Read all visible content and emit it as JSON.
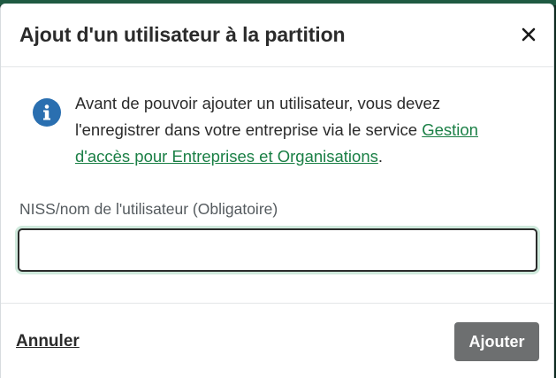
{
  "dialog": {
    "title": "Ajout d'un utilisateur à la partition",
    "close_icon": "close-icon"
  },
  "info": {
    "icon": "info-icon",
    "text_before": "Avant de pouvoir ajouter un utilisateur, vous devez l'enregistrer dans votre entreprise via le service ",
    "link_text": "Gestion d'accès pour Entreprises et Organisations",
    "text_after": ".",
    "link_color": "#1a7f45",
    "icon_color": "#2a6fb0"
  },
  "field": {
    "label": "NISS/nom de l'utilisateur (Obligatoire)",
    "value": "",
    "placeholder": ""
  },
  "footer": {
    "cancel_label": "Annuler",
    "submit_label": "Ajouter",
    "submit_color": "#6d6f70"
  }
}
